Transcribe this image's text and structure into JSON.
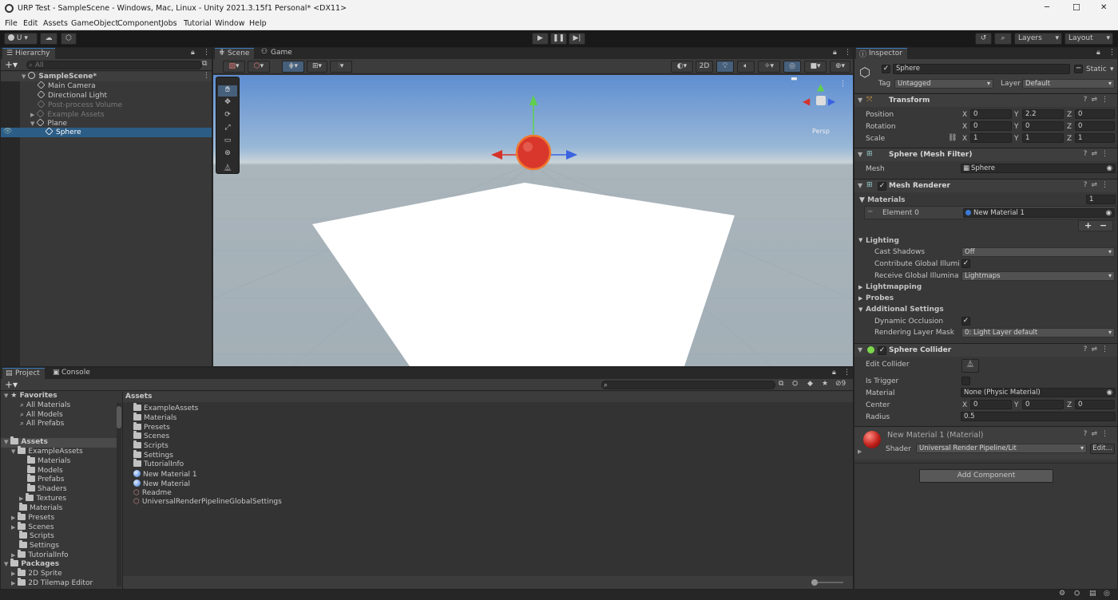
{
  "titlebar": {
    "title": "URP Test - SampleScene - Windows, Mac, Linux - Unity 2021.3.15f1 Personal* <DX11>",
    "minimize": "─",
    "maximize": "☐",
    "close": "✕"
  },
  "menu": [
    "File",
    "Edit",
    "Assets",
    "GameObject",
    "Component",
    "Jobs",
    "Tutorial",
    "Window",
    "Help"
  ],
  "toolbar": {
    "account": "U",
    "layers": "Layers",
    "layout": "Layout"
  },
  "hierarchy": {
    "tab": "Hierarchy",
    "search_placeholder": "All",
    "scene": "SampleScene*",
    "items": [
      {
        "label": "Main Camera",
        "dim": false
      },
      {
        "label": "Directional Light",
        "dim": false
      },
      {
        "label": "Post-process Volume",
        "dim": true
      },
      {
        "label": "Example Assets",
        "dim": true
      },
      {
        "label": "Plane",
        "dim": false
      },
      {
        "label": "Sphere",
        "dim": false
      }
    ]
  },
  "scene_view": {
    "tab_scene": "Scene",
    "tab_game": "Game",
    "mode_2d": "2D",
    "persp": "Persp"
  },
  "project": {
    "tab_project": "Project",
    "tab_console": "Console",
    "hidden_count": "9",
    "favorites": {
      "title": "Favorites",
      "items": [
        "All Materials",
        "All Models",
        "All Prefabs"
      ]
    },
    "assets_tree": {
      "title": "Assets",
      "example": "ExampleAssets",
      "example_children": [
        "Materials",
        "Models",
        "Prefabs",
        "Shaders",
        "Textures"
      ],
      "others": [
        "Materials",
        "Presets",
        "Scenes",
        "Scripts",
        "Settings",
        "TutorialInfo"
      ]
    },
    "packages": {
      "title": "Packages",
      "items": [
        "2D Sprite",
        "2D Tilemap Editor"
      ]
    },
    "content_title": "Assets",
    "content_items": [
      {
        "label": "ExampleAssets",
        "kind": "folder"
      },
      {
        "label": "Materials",
        "kind": "folder"
      },
      {
        "label": "Presets",
        "kind": "folder"
      },
      {
        "label": "Scenes",
        "kind": "folder"
      },
      {
        "label": "Scripts",
        "kind": "folder"
      },
      {
        "label": "Settings",
        "kind": "folder"
      },
      {
        "label": "TutorialInfo",
        "kind": "folder"
      },
      {
        "label": "New Material 1",
        "kind": "material"
      },
      {
        "label": "New Material",
        "kind": "material"
      },
      {
        "label": "Readme",
        "kind": "asset"
      },
      {
        "label": "UniversalRenderPipelineGlobalSettings",
        "kind": "asset"
      }
    ]
  },
  "inspector": {
    "tab": "Inspector",
    "object_name": "Sphere",
    "static_label": "Static",
    "tag_label": "Tag",
    "tag_value": "Untagged",
    "layer_label": "Layer",
    "layer_value": "Default",
    "transform": {
      "title": "Transform",
      "position_label": "Position",
      "rotation_label": "Rotation",
      "scale_label": "Scale",
      "position": {
        "x": "0",
        "y": "2.2",
        "z": "0"
      },
      "rotation": {
        "x": "0",
        "y": "0",
        "z": "0"
      },
      "scale": {
        "x": "1",
        "y": "1",
        "z": "1"
      }
    },
    "axis": {
      "x": "X",
      "y": "Y",
      "z": "Z"
    },
    "mesh_filter": {
      "title": "Sphere (Mesh Filter)",
      "mesh_label": "Mesh",
      "mesh_value": "Sphere"
    },
    "mesh_renderer": {
      "title": "Mesh Renderer",
      "materials_label": "Materials",
      "materials_count": "1",
      "element0_label": "Element 0",
      "element0_value": "New Material 1",
      "lighting": "Lighting",
      "cast_shadows_label": "Cast Shadows",
      "cast_shadows_value": "Off",
      "contribute_gi_label": "Contribute Global Illuminat",
      "receive_gi_label": "Receive Global Illuminatio",
      "receive_gi_value": "Lightmaps",
      "lightmapping": "Lightmapping",
      "probes": "Probes",
      "additional": "Additional Settings",
      "dynamic_occlusion_label": "Dynamic Occlusion",
      "rendering_layer_label": "Rendering Layer Mask",
      "rendering_layer_value": "0: Light Layer default"
    },
    "sphere_collider": {
      "title": "Sphere Collider",
      "edit_label": "Edit Collider",
      "trigger_label": "Is Trigger",
      "material_label": "Material",
      "material_value": "None (Physic Material)",
      "center_label": "Center",
      "center": {
        "x": "0",
        "y": "0",
        "z": "0"
      },
      "radius_label": "Radius",
      "radius_value": "0.5"
    },
    "material": {
      "title": "New Material 1 (Material)",
      "shader_label": "Shader",
      "shader_value": "Universal Render Pipeline/Lit",
      "edit_label": "Edit..."
    },
    "add_component": "Add Component"
  },
  "colors": {
    "accent": "#3a79bb",
    "selection": "#2c5d87",
    "sphere": "#d9372c",
    "sky_top": "#5e8ed1",
    "ground": "#a9b4bb"
  }
}
